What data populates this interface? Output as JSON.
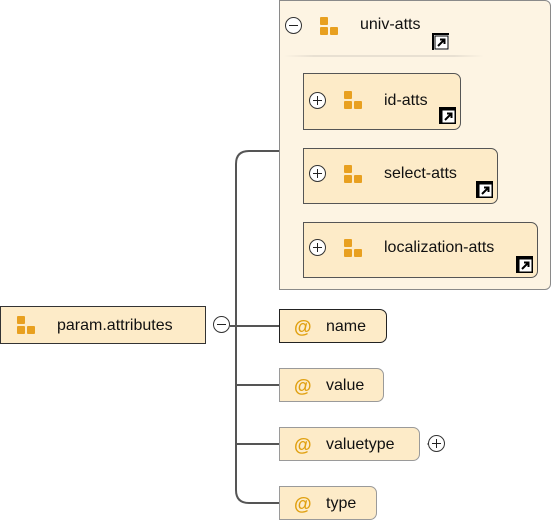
{
  "diagram": {
    "root": {
      "label": "param.attributes",
      "icon": "element-icon",
      "toggle": "collapse-icon"
    },
    "group": {
      "label": "univ-atts",
      "icon": "element-icon",
      "toggle": "collapse-icon",
      "children": [
        {
          "label": "id-atts",
          "toggle": "expand-icon"
        },
        {
          "label": "select-atts",
          "toggle": "expand-icon"
        },
        {
          "label": "localization-atts",
          "toggle": "expand-icon"
        }
      ]
    },
    "attributes": [
      {
        "symbol": "@",
        "label": "name",
        "required": true
      },
      {
        "symbol": "@",
        "label": "value",
        "required": false
      },
      {
        "symbol": "@",
        "label": "valuetype",
        "required": false,
        "expandable": true
      },
      {
        "symbol": "@",
        "label": "type",
        "required": false
      }
    ],
    "colors": {
      "node_fill": "#fdebc8",
      "group_fill": "#fdf4e3",
      "icon": "#e8a020",
      "connector": "#555555"
    }
  }
}
